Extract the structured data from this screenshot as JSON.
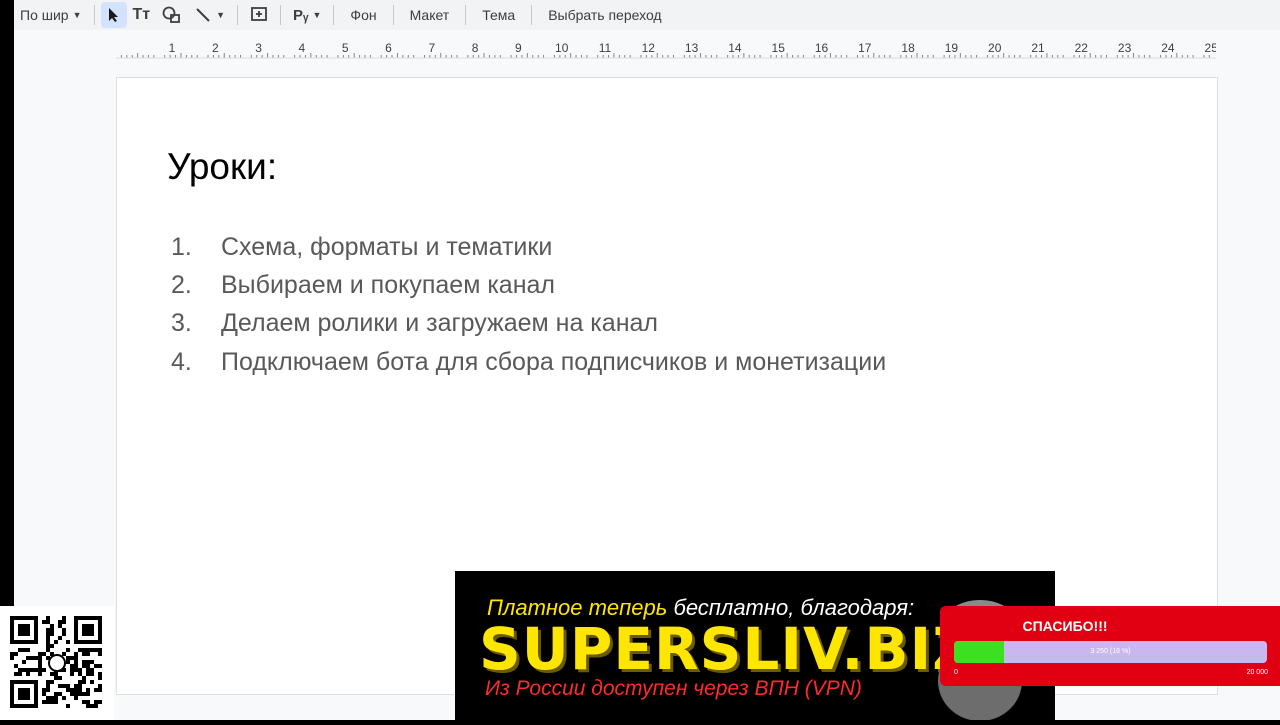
{
  "toolbar": {
    "zoom_label": "По шир",
    "items": [
      "Фон",
      "Макет",
      "Тема",
      "Выбрать переход"
    ]
  },
  "ruler": {
    "labels": [
      "1",
      "2",
      "3",
      "4",
      "5",
      "6",
      "7",
      "8",
      "9",
      "10",
      "11",
      "12",
      "13",
      "14",
      "15",
      "16",
      "17",
      "18",
      "19",
      "20",
      "21",
      "22",
      "23",
      "24",
      "25"
    ]
  },
  "slide": {
    "title": "Уроки:",
    "lessons": [
      {
        "num": "1.",
        "text": "Схема, форматы и тематики"
      },
      {
        "num": "2.",
        "text": "Выбираем и покупаем канал"
      },
      {
        "num": "3.",
        "text": "Делаем ролики и загружаем на канал"
      },
      {
        "num": "4.",
        "text": "Подключаем бота для сбора подписчиков и монетизации"
      }
    ]
  },
  "banner": {
    "line1_white": "Платное теперь",
    "line1_rest": "бесплатно, благодаря:",
    "logo": "SUPERSLIV.BIZ",
    "line3": "Из России доступен через ВПН (VPN)"
  },
  "donation": {
    "title": "СПАСИБО!!!",
    "progress_label": "3 250 (16 %)",
    "progress_fraction": 0.16,
    "min": "0",
    "max": "20 000",
    "colors": {
      "bg": "#e00012",
      "fill": "#3de020",
      "track": "#c9b8f0"
    }
  },
  "icons": [
    "select-cursor-icon",
    "text-box-icon",
    "shapes-icon",
    "line-icon",
    "insert-comment-icon",
    "text-format-icon"
  ]
}
